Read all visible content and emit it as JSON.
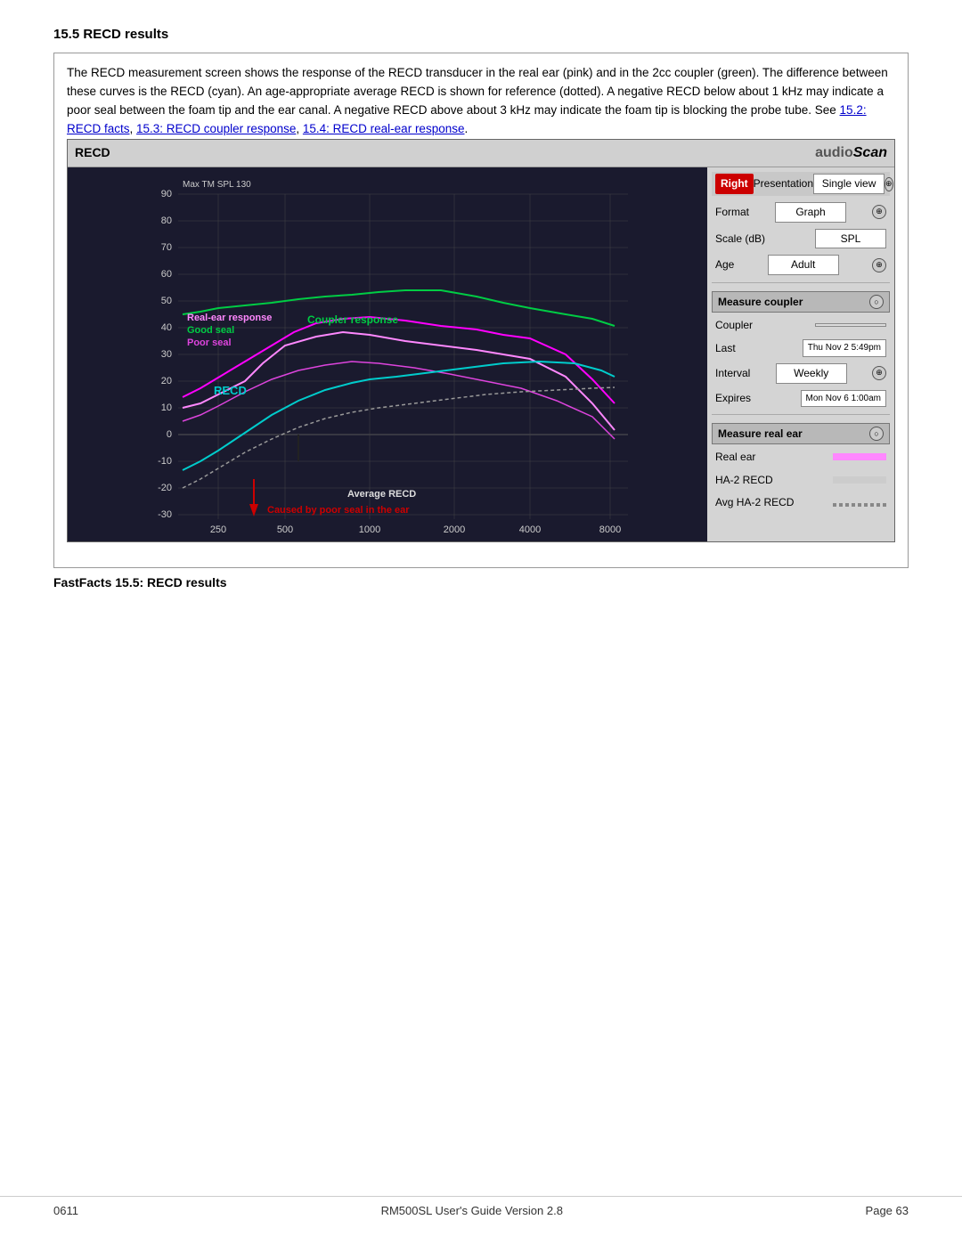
{
  "heading": "15.5  RECD results",
  "description": {
    "text": "The RECD measurement screen shows the response of the RECD transducer in the real ear (pink) and in the 2cc coupler (green). The difference between these curves is the RECD (cyan). An age-appropriate average RECD is shown for reference (dotted). A negative RECD below about 1 kHz may indicate a poor seal between the foam tip and the ear canal. A negative RECD above about 3 kHz may indicate the foam tip is blocking the probe tube. See ",
    "link1": "15.2: RECD facts",
    "link2": "15.3: RECD coupler response",
    "link3": "15.4: RECD real-ear response"
  },
  "recd_panel": {
    "title": "RECD",
    "logo_audio": "audio",
    "logo_scan": "Scan",
    "right_badge": "Right",
    "sidebar": {
      "presentation_label": "Presentation",
      "presentation_value": "Single view",
      "format_label": "Format",
      "format_value": "Graph",
      "scale_label": "Scale (dB)",
      "scale_value": "SPL",
      "age_label": "Age",
      "age_value": "Adult",
      "measure_coupler_btn": "Measure coupler",
      "coupler_label": "Coupler",
      "coupler_value": "",
      "last_label": "Last",
      "last_value": "Thu Nov 2 5:49pm",
      "interval_label": "Interval",
      "interval_value": "Weekly",
      "expires_label": "Expires",
      "expires_value": "Mon Nov 6 1:00am",
      "measure_real_ear_btn": "Measure real ear",
      "real_ear_label": "Real ear",
      "ha2_recd_label": "HA-2 RECD",
      "avg_ha2_recd_label": "Avg HA-2 RECD"
    },
    "graph": {
      "y_max": 90,
      "y_min": -30,
      "y_label": "Max TM SPL 130",
      "x_labels": [
        "250",
        "500",
        "1000",
        "2000",
        "4000",
        "8000"
      ],
      "annotations": [
        {
          "text": "Real-ear response",
          "color": "#ff00ff"
        },
        {
          "text": "Good seal",
          "color": "#00aa00"
        },
        {
          "text": "Poor seal",
          "color": "#cc00cc"
        },
        {
          "text": "Coupler response",
          "color": "#00cc00"
        },
        {
          "text": "RECD",
          "color": "#00cccc"
        },
        {
          "text": "Average RECD",
          "color": "#222"
        },
        {
          "text": "Caused by poor seal in the ear",
          "color": "#cc0000"
        }
      ]
    }
  },
  "fastfacts": "FastFacts 15.5: RECD results",
  "footer": {
    "left": "0611",
    "center": "RM500SL User's Guide Version 2.8",
    "right": "Page 63"
  }
}
